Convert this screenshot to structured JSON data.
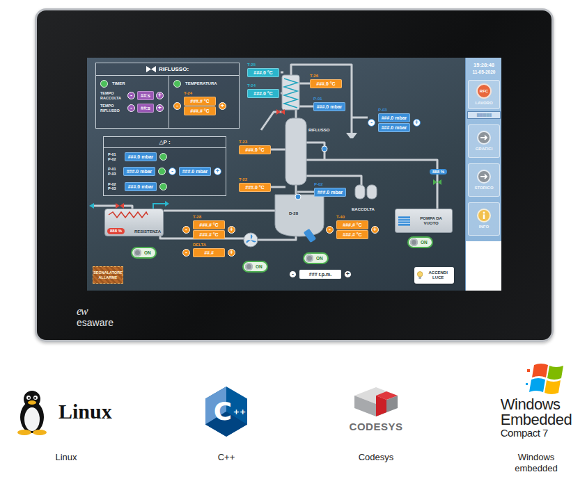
{
  "device": {
    "brand_mark": "ew",
    "brand": "esaware"
  },
  "stepper_keys": {
    "minus": "-",
    "plus": "+"
  },
  "reflux_panel": {
    "title": "RIFLUSSO:",
    "timer": {
      "label": "TIMER",
      "on": true
    },
    "temperature": {
      "label": "TEMPERATURA",
      "on": true
    },
    "settings": [
      {
        "label": [
          "TEMPO",
          "RACCOLTA"
        ],
        "value": "##:s",
        "color": "#9b59b6"
      },
      {
        "label": [
          "TEMPO",
          "RIFLUSSO"
        ],
        "value": "##:s",
        "color": "#9b59b6"
      }
    ],
    "setpoint": {
      "label": "T-24",
      "values": [
        "###.# °C",
        "###.# °C"
      ],
      "stepper": true,
      "kind": "temperature",
      "color": "#f7941d"
    }
  },
  "delta_p_panel": {
    "title": "△P :",
    "rows": [
      {
        "labels": [
          "P-01",
          "P-02"
        ],
        "value": "###.0 mbar",
        "on": true,
        "setpoint": ""
      },
      {
        "labels": [
          "P-01",
          "P-03"
        ],
        "value": "###.0 mbar",
        "on": true,
        "setpoint": "###.0 mbar"
      },
      {
        "labels": [
          "P-02",
          "P-03"
        ],
        "value": "###.0 mbar",
        "on": true,
        "setpoint": ""
      }
    ]
  },
  "tags": [
    {
      "label": "T-25",
      "values": [
        "###.0 °C"
      ],
      "stepper": false,
      "kind": "temperature",
      "color": "#2bb5cc"
    },
    {
      "label": "T-24",
      "values": [
        "###.0 °C"
      ],
      "stepper": false,
      "kind": "temperature",
      "color": "#2bb5cc"
    },
    {
      "label": "T-26",
      "values": [
        "###.0 °C"
      ],
      "stepper": false,
      "kind": "temperature",
      "color": "#f7941d"
    },
    {
      "label": "P-01",
      "values": [
        "###.0 mbar"
      ],
      "stepper": false,
      "kind": "pressure",
      "color": "#3b8fd9"
    },
    {
      "label": "T-23",
      "values": [
        "###.0 °C"
      ],
      "stepper": false,
      "kind": "temperature",
      "color": "#f7941d"
    },
    {
      "label": "T-22",
      "values": [
        "###.0 °C"
      ],
      "stepper": false,
      "kind": "temperature",
      "color": "#f7941d"
    },
    {
      "label": "P-02",
      "values": [
        "###.0 mbar"
      ],
      "stepper": false,
      "kind": "pressure",
      "color": "#3b8fd9"
    },
    {
      "label": "P-03",
      "values": [
        "###.0 mbar",
        "###.0 mbar"
      ],
      "stepper": true,
      "kind": "pressure",
      "color": "#3b8fd9"
    },
    {
      "label": "T-28",
      "values": [
        "###.# °C",
        "###.# °C"
      ],
      "stepper": true,
      "kind": "temperature",
      "color": "#f7941d"
    },
    {
      "label": "DELTA",
      "values": [
        "##.#"
      ],
      "stepper": true,
      "kind": "temperature",
      "color": "#f7941d"
    },
    {
      "label": "T-40",
      "values": [
        "###.# °C",
        "###.# °C"
      ],
      "stepper": true,
      "kind": "temperature",
      "color": "#f7941d"
    }
  ],
  "diagram_labels": {
    "reflux": "RIFLUSSO",
    "vessel": "D-28",
    "collection": "BACCOLTA",
    "vacuum_pump": "POMPA DA VUOTO",
    "heater": "RESISTENZA"
  },
  "outputs": [
    {
      "reading": "888 %",
      "color": "#e0453a"
    },
    {
      "reading": "888 %",
      "color": "#3b8fd9"
    }
  ],
  "valves": [
    {
      "open": false
    },
    {
      "open": false
    },
    {
      "open": true
    }
  ],
  "switches": [
    {
      "label": "ON",
      "on": true
    },
    {
      "label": "ON",
      "on": true
    },
    {
      "label": "ON",
      "on": true
    },
    {
      "label": "ON",
      "on": true
    }
  ],
  "speed": {
    "value": "### r.p.m."
  },
  "light_button": {
    "label": "ACCENDI LUCE"
  },
  "alarm": {
    "label": "SEGNALATORE ALLARME",
    "active": false
  },
  "sidebar": {
    "time": "15:28:48",
    "date": "11-05-2020",
    "status": {
      "label": "RFC",
      "caption": "LAVORO",
      "color": "#e8673c"
    },
    "progress": {
      "text": "||||||||||||||||||||",
      "level": 1
    },
    "nav": [
      {
        "label": "GRAFICI",
        "kind": "arrow"
      },
      {
        "label": "STORICO",
        "kind": "arrow"
      },
      {
        "label": "INFO",
        "kind": "info"
      }
    ]
  },
  "logos": [
    {
      "kind": "linux",
      "wordmark": [
        "Linux"
      ],
      "caption": "Linux"
    },
    {
      "kind": "cpp",
      "wordmark": [
        "C",
        "++"
      ],
      "caption": "C++"
    },
    {
      "kind": "codesys",
      "wordmark": [
        "CODESYS"
      ],
      "caption": "Codesys"
    },
    {
      "kind": "windows",
      "wordmark": [
        "Windows",
        "Embedded",
        "Compact 7"
      ],
      "caption": "Windows embedded"
    }
  ]
}
